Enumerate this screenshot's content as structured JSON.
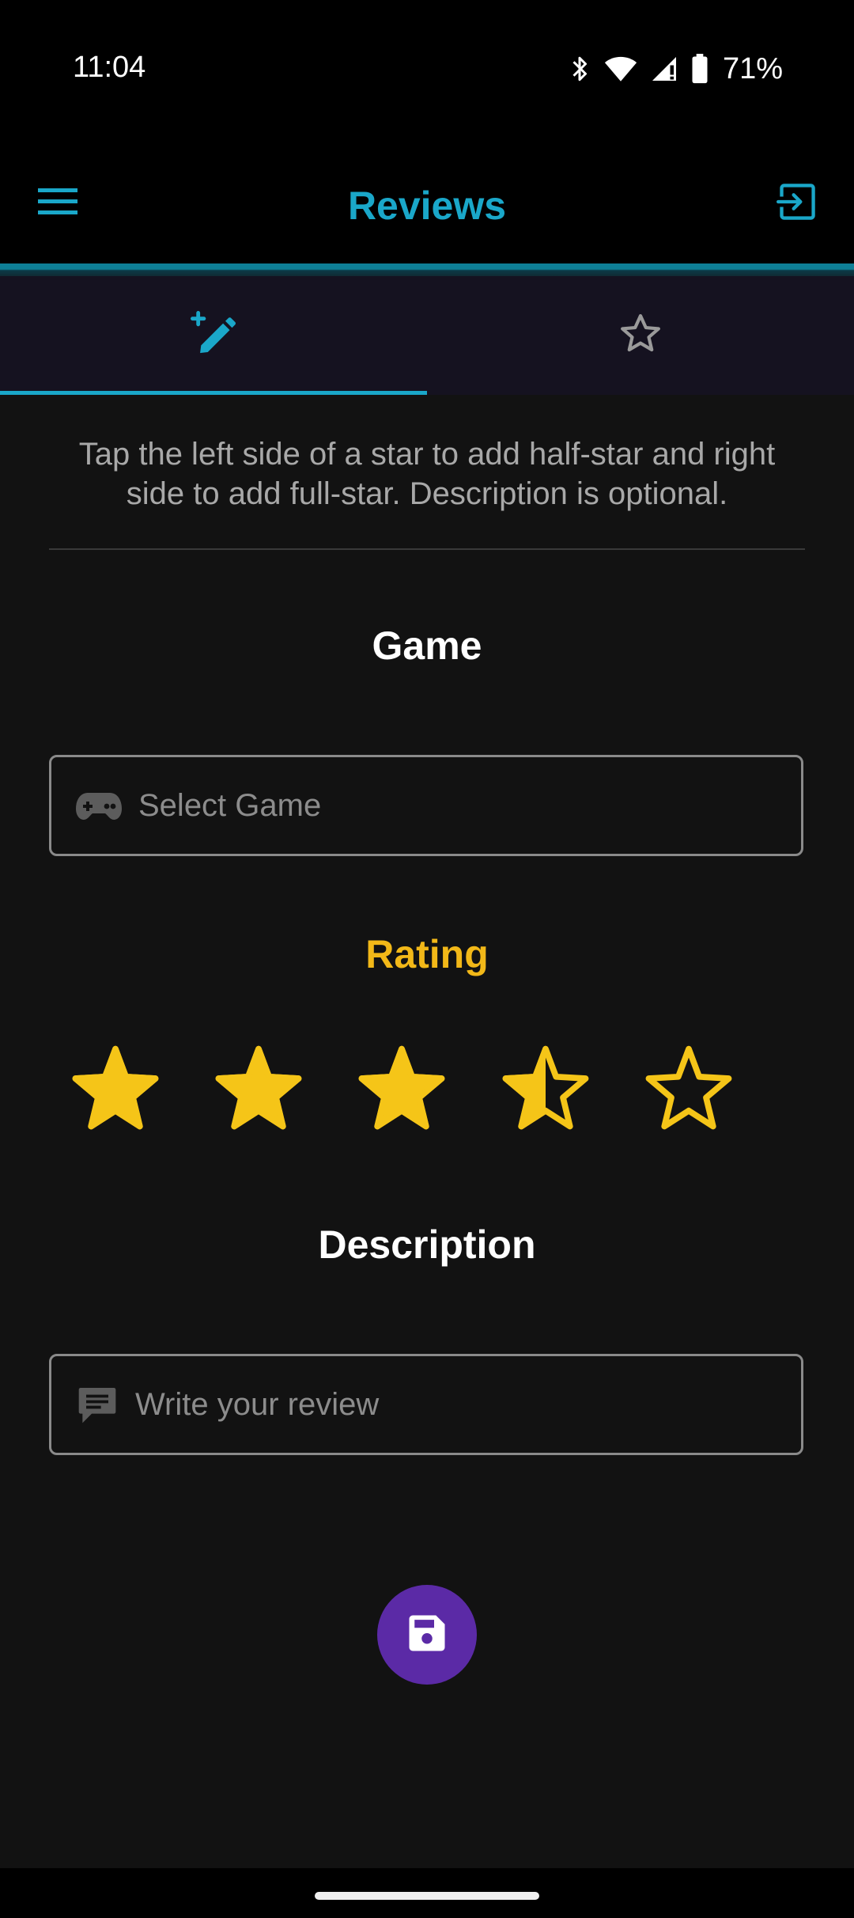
{
  "status_bar": {
    "time": "11:04",
    "battery_percent": "71%",
    "icons": [
      "bluetooth-icon",
      "wifi-icon",
      "cell-signal-icon",
      "battery-icon"
    ]
  },
  "app_bar": {
    "title": "Reviews",
    "accent_color": "#1aa7c9",
    "left_icon": "menu-icon",
    "right_icon": "logout-icon"
  },
  "tabs": [
    {
      "name": "write-review",
      "icon": "edit-plus-icon",
      "selected": true
    },
    {
      "name": "my-reviews",
      "icon": "star-outline-icon",
      "selected": false
    }
  ],
  "main": {
    "hint": "Tap the left side of a star to add half-star and right side to add full-star. Description is optional.",
    "game_section": {
      "title": "Game",
      "placeholder": "Select Game",
      "icon": "gamepad-icon"
    },
    "rating_section": {
      "title": "Rating",
      "title_color": "#f2b818",
      "value": 3.5,
      "max": 5,
      "star_color": "#f5c518"
    },
    "description_section": {
      "title": "Description",
      "placeholder": "Write your review",
      "icon": "comment-icon"
    },
    "save_button": {
      "icon": "save-icon",
      "color": "#5b2aa6"
    }
  }
}
